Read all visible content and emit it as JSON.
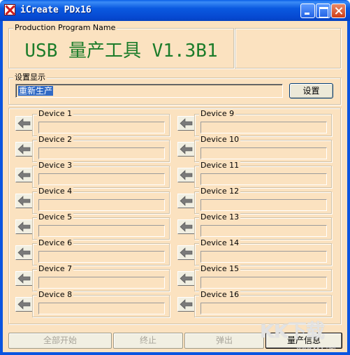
{
  "window": {
    "title": "iCreate PDx16"
  },
  "production": {
    "label": "Production Program Name",
    "heading": "USB 量产工具 V1.3B1"
  },
  "display": {
    "label": "设置显示",
    "value": "重新生产",
    "settings_button": "设置"
  },
  "devices": [
    "Device 1",
    "Device 2",
    "Device 3",
    "Device 4",
    "Device 5",
    "Device 6",
    "Device 7",
    "Device 8",
    "Device 9",
    "Device 10",
    "Device 11",
    "Device 12",
    "Device 13",
    "Device 14",
    "Device 15",
    "Device 16"
  ],
  "buttons": {
    "start_all": "全部开始",
    "stop": "终止",
    "eject": "弹出",
    "info": "量产信息"
  },
  "watermark": {
    "text": "KK下载",
    "url": "www.kkx.net"
  },
  "colors": {
    "titlebar": "#0a54e0",
    "client_bg": "#fbe2c0",
    "heading": "#1c7c2a",
    "selection": "#316ac5"
  }
}
